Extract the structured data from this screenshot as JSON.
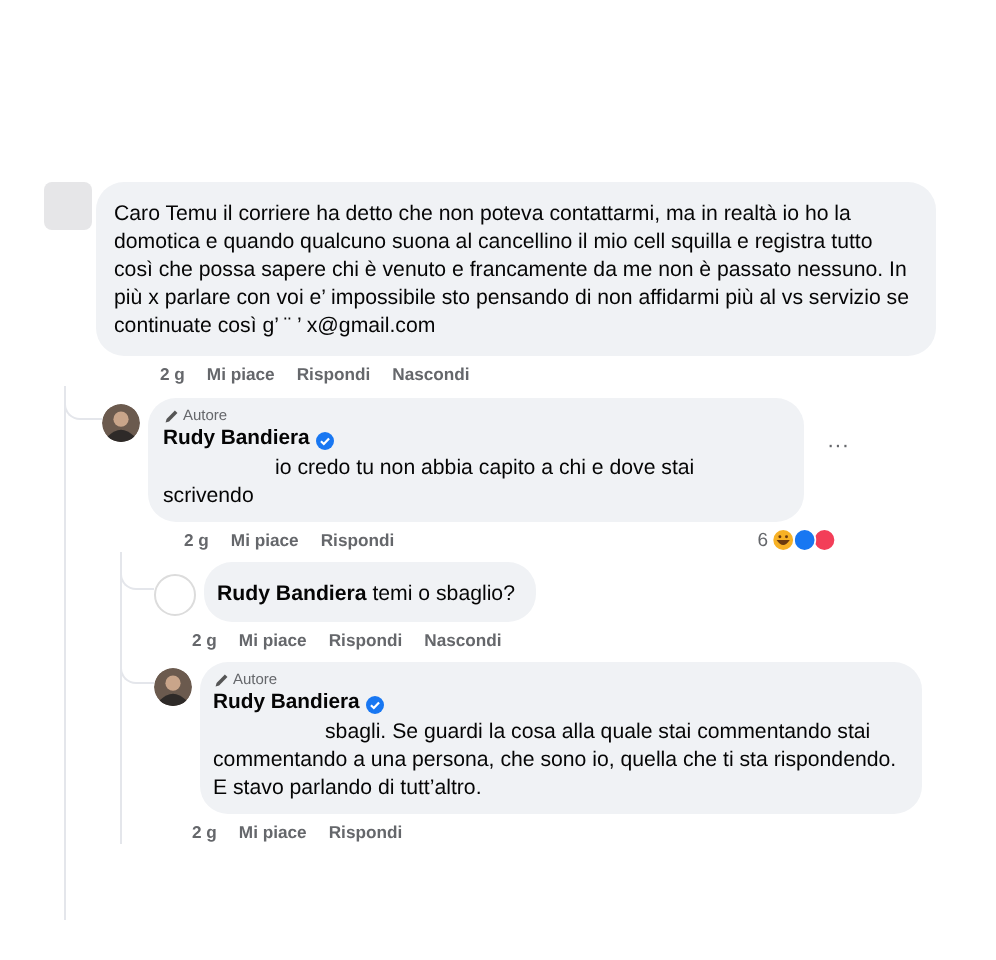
{
  "comments": [
    {
      "avatar": {
        "kind": "blurred"
      },
      "text": "Caro Temu il corriere ha detto che non poteva contattarmi, ma in realtà io ho la domotica e quando qualcuno suona al cancellino il mio cell squilla e registra tutto così che possa sapere chi è venuto e francamente da me non è passato nessuno. In più x parlare con voi e’ impossibile sto pensando di non affidarmi più al vs servizio se continuate così g’  ¨  ’ x@gmail.com",
      "actions": [
        "2 g",
        "Mi piace",
        "Rispondi",
        "Nascondi"
      ],
      "replies": [
        {
          "avatar": {
            "kind": "photo"
          },
          "badge": "Autore",
          "author": "Rudy Bandiera",
          "verified": true,
          "text": "io credo tu non abbia capito a chi e dove stai scrivendo",
          "more": "···",
          "actions": [
            "2 g",
            "Mi piace",
            "Rispondi"
          ],
          "reactions": {
            "count": "6"
          },
          "replies": [
            {
              "avatar": {
                "kind": "blank"
              },
              "text": "**Rudy Bandiera** temi o sbaglio?",
              "actions": [
                "2 g",
                "Mi piace",
                "Rispondi",
                "Nascondi"
              ]
            },
            {
              "avatar": {
                "kind": "photo"
              },
              "badge": "Autore",
              "author": "Rudy Bandiera",
              "verified": true,
              "text": "sbagli. Se guardi la cosa alla quale stai commentando stai commentando a una persona, che sono io, quella che ti sta rispondendo. E stavo parlando di tutt’altro.",
              "actions": [
                "2 g",
                "Mi piace",
                "Rispondi"
              ]
            }
          ]
        }
      ]
    }
  ]
}
